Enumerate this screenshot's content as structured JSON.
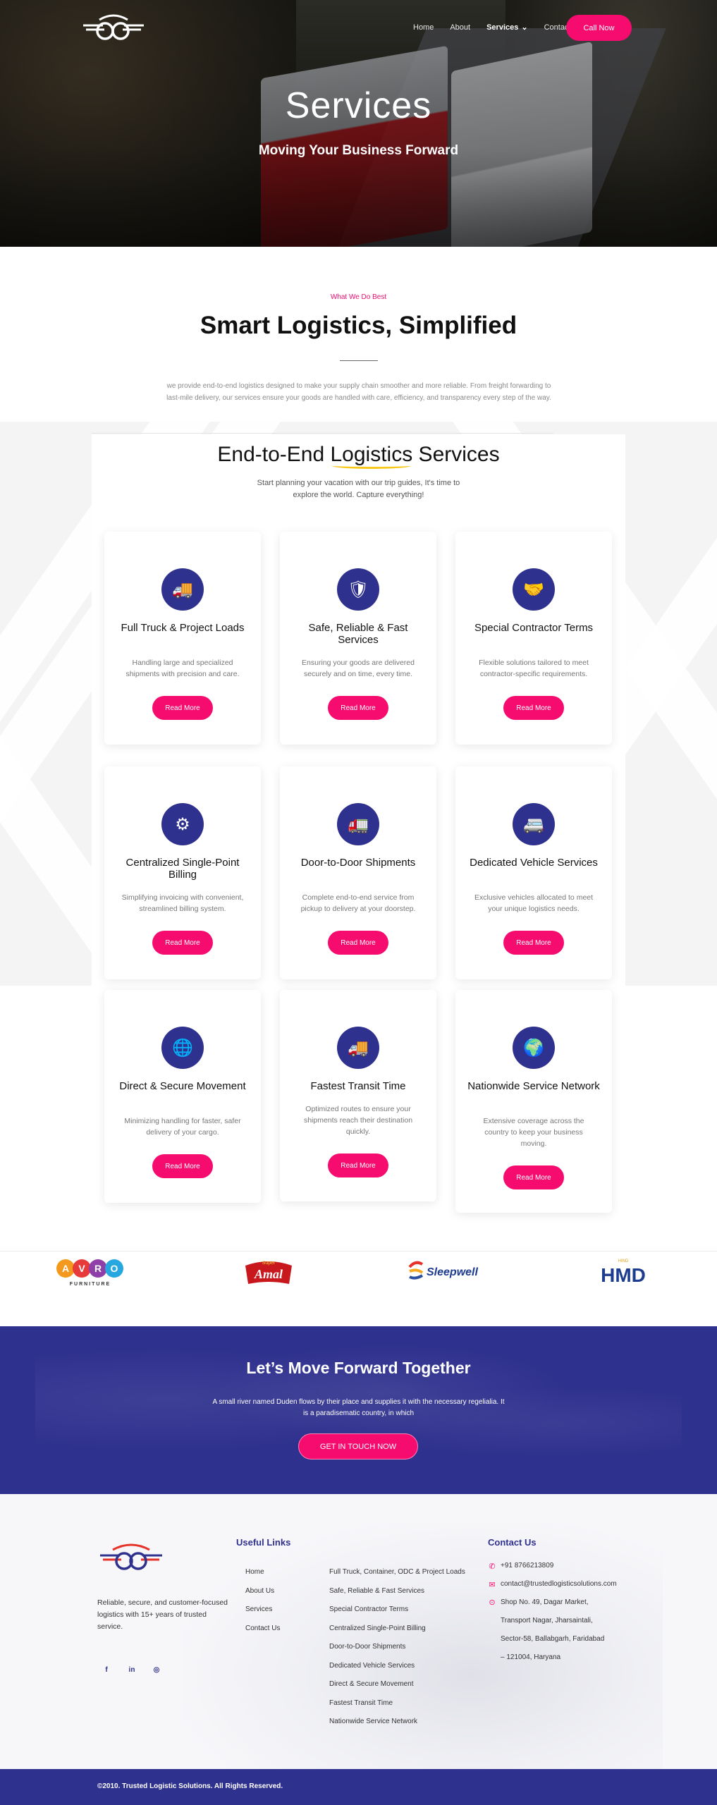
{
  "nav": {
    "links": [
      {
        "label": "Home"
      },
      {
        "label": "About"
      },
      {
        "label": "Services",
        "caret": "⌄"
      },
      {
        "label": "Contact"
      }
    ],
    "call_label": "Call Now"
  },
  "hero": {
    "title": "Services",
    "subtitle": "Moving Your Business Forward"
  },
  "intro": {
    "eyebrow": "What We Do Best",
    "title": "Smart Logistics, Simplified",
    "text": "we provide end-to-end logistics designed to make your supply chain smoother and more reliable. From freight forwarding to last-mile delivery, our services ensure your goods are handled with care, efficiency, and transparency every step of the way."
  },
  "services_section": {
    "title_pre": "End-to-End ",
    "title_highlight": "Logistics",
    "title_post": " Services",
    "text": "Start planning your vacation with our trip guides, It's time to explore the world. Capture everything!"
  },
  "cards": [
    {
      "icon": "truck-cargo-icon",
      "glyph": "🚚",
      "title": "Full Truck & Project Loads",
      "desc": "Handling large and specialized shipments with precision and care.",
      "button": "Read More"
    },
    {
      "icon": "shield-check-icon",
      "glyph": "🛡",
      "title": "Safe, Reliable & Fast Services",
      "desc": "Ensuring your goods are delivered securely and on time, every time.",
      "button": "Read More"
    },
    {
      "icon": "handshake-icon",
      "glyph": "🤝",
      "title": "Special Contractor Terms",
      "desc": "Flexible solutions tailored to meet contractor-specific requirements.",
      "button": "Read More"
    },
    {
      "icon": "billing-network-icon",
      "glyph": "⚙",
      "title": "Centralized Single-Point Billing",
      "desc": "Simplifying invoicing with convenient, streamlined billing system.",
      "button": "Read More"
    },
    {
      "icon": "delivery-truck-icon",
      "glyph": "🚛",
      "title": "Door-to-Door Shipments",
      "desc": "Complete end-to-end service from pickup to delivery at your doorstep.",
      "button": "Read More"
    },
    {
      "icon": "dedicated-vehicle-icon",
      "glyph": "🚐",
      "title": "Dedicated Vehicle Services",
      "desc": "Exclusive vehicles allocated to meet your unique logistics needs.",
      "button": "Read More"
    },
    {
      "icon": "globe-secure-icon",
      "glyph": "🌐",
      "title": "Direct & Secure Movement",
      "desc": "Minimizing handling for faster, safer delivery of your cargo.",
      "button": "Read More"
    },
    {
      "icon": "fast-truck-icon",
      "glyph": "🚚",
      "title": "Fastest Transit Time",
      "desc": "Optimized routes to ensure your shipments reach their destination quickly.",
      "button": "Read More"
    },
    {
      "icon": "globe-network-icon",
      "glyph": "🌍",
      "title": "Nationwide Service Network",
      "desc": "Extensive coverage across the country to keep your business moving.",
      "button": "Read More"
    }
  ],
  "brands": [
    {
      "name": "AVRO",
      "sub": "FURNITURE"
    },
    {
      "name": "Amal",
      "sub": "Super"
    },
    {
      "name": "Sleepwell",
      "sub": ""
    },
    {
      "name": "HMD",
      "sub": "HIND"
    }
  ],
  "cta": {
    "title": "Let’s Move Forward Together",
    "text": "A small river named Duden flows by their place and supplies it with the necessary regelialia. It is a paradisematic country, in which",
    "button": "GET IN TOUCH NOW"
  },
  "footer": {
    "tagline": "Reliable, secure, and customer-focused logistics with 15+ years of trusted service.",
    "social": [
      {
        "icon": "facebook-icon",
        "glyph": "f"
      },
      {
        "icon": "linkedin-icon",
        "glyph": "in"
      },
      {
        "icon": "instagram-icon",
        "glyph": "◎"
      }
    ],
    "useful_links_title": "Useful Links",
    "links_col1": [
      "Home",
      "About Us",
      "Services",
      "Contact Us"
    ],
    "links_col2": [
      "Full Truck, Container, ODC & Project Loads",
      "Safe, Reliable & Fast Services",
      "Special Contractor Terms",
      "Centralized Single-Point Billing",
      "Door-to-Door Shipments",
      "Dedicated Vehicle Services",
      "Direct & Secure Movement",
      "Fastest Transit Time",
      "Nationwide Service Network"
    ],
    "contact_title": "Contact Us",
    "phone": "+91 8766213809",
    "email": "contact@trustedlogisticsolutions.com",
    "address_lines": [
      "Shop No. 49, Dagar Market,",
      "Transport Nagar, Jharsaintali,",
      "Sector-58, Ballabgarh, Faridabad",
      "– 121004, Haryana"
    ],
    "copyright": "©2010. Trusted Logistic Solutions. All Rights Reserved."
  },
  "colors": {
    "accent": "#f50c6e",
    "brand_navy": "#2f318e",
    "highlight_underline": "#f6c81a"
  }
}
